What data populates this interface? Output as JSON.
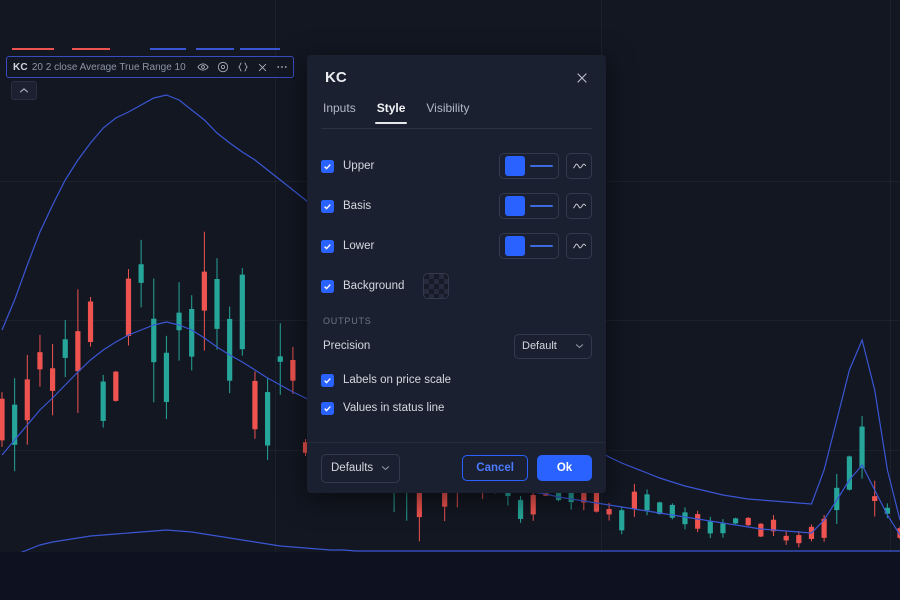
{
  "colors": {
    "accent": "#2962ff",
    "panel_bg": "#1b2030",
    "chart_bg": "#131722",
    "page_bg": "#0e1220",
    "band_line": "#3a56d4",
    "candle_up": "#26a69a",
    "candle_down": "#ef5350",
    "text_primary": "#d4d7de",
    "text_muted": "#6e7585"
  },
  "legend": {
    "name": "KC",
    "params": "20 2 close Average True Range 10",
    "icons": [
      "eye-icon",
      "settings-icon",
      "source-code-icon",
      "close-icon",
      "more-options-icon"
    ]
  },
  "chart": {
    "collapse_label": "⌃"
  },
  "modal": {
    "title": "KC",
    "close_label": "×",
    "tabs": [
      {
        "label": "Inputs",
        "active": false
      },
      {
        "label": "Style",
        "active": true
      },
      {
        "label": "Visibility",
        "active": false
      }
    ],
    "style_rows": [
      {
        "label": "Upper",
        "checked": true,
        "color": "#2962ff",
        "line_style": "wave-icon"
      },
      {
        "label": "Basis",
        "checked": true,
        "color": "#2962ff",
        "line_style": "wave-icon"
      },
      {
        "label": "Lower",
        "checked": true,
        "color": "#2962ff",
        "line_style": "wave-icon"
      }
    ],
    "background_row": {
      "label": "Background",
      "checked": true,
      "swatch": "transparent-checkered"
    },
    "outputs_section": {
      "header": "Outputs",
      "precision_label": "Precision",
      "precision_value": "Default",
      "checkboxes": [
        {
          "label": "Labels on price scale",
          "checked": true
        },
        {
          "label": "Values in status line",
          "checked": true
        }
      ]
    },
    "footer": {
      "defaults_label": "Defaults",
      "cancel_label": "Cancel",
      "ok_label": "Ok"
    }
  },
  "chart_data": {
    "type": "line",
    "title": "",
    "xlabel": "",
    "ylabel": "",
    "series": [
      {
        "name": "Upper",
        "values": [
          330,
          300,
          265,
          232,
          205,
          180,
          160,
          143,
          128,
          118,
          112,
          105,
          98,
          95,
          100,
          110,
          120,
          133,
          143,
          152,
          160,
          170,
          180,
          190,
          200,
          213,
          222,
          213,
          225,
          240,
          258,
          272,
          285,
          300,
          318,
          332,
          345,
          358,
          370,
          382,
          392,
          403,
          412,
          420,
          428,
          436,
          443,
          450,
          457,
          463,
          468,
          473,
          478,
          482,
          486,
          489,
          492,
          495,
          497,
          499,
          500,
          501,
          502,
          503,
          504,
          470,
          420,
          370,
          340,
          390,
          470,
          520
        ]
      },
      {
        "name": "Basis",
        "values": [
          455,
          440,
          425,
          410,
          398,
          385,
          372,
          360,
          350,
          342,
          335,
          330,
          325,
          322,
          325,
          330,
          338,
          347,
          355,
          362,
          370,
          378,
          385,
          392,
          398,
          405,
          410,
          415,
          420,
          427,
          434,
          440,
          447,
          453,
          459,
          464,
          469,
          474,
          478,
          482,
          486,
          489,
          492,
          494,
          497,
          499,
          501,
          503,
          505,
          507,
          509,
          511,
          513,
          515,
          517,
          519,
          521,
          523,
          525,
          527,
          529,
          530,
          531,
          532,
          533,
          520,
          500,
          480,
          465,
          490,
          515,
          535
        ]
      },
      {
        "name": "Lower",
        "values": [
          560,
          555,
          550,
          545,
          542,
          540,
          538,
          536,
          535,
          534,
          533,
          532,
          531,
          530,
          531,
          532,
          534,
          536,
          538,
          540,
          542,
          544,
          546,
          547,
          548,
          549,
          550,
          550,
          551,
          551,
          551,
          551,
          551,
          551,
          551,
          551,
          551,
          551,
          551,
          551,
          551,
          551,
          551,
          551,
          551,
          551,
          551,
          551,
          551,
          551,
          551,
          551,
          551,
          551,
          551,
          551,
          551,
          551,
          551,
          551,
          551,
          551,
          551,
          551,
          551,
          551,
          551,
          551,
          551,
          551,
          551,
          551
        ]
      }
    ],
    "legend_position": "top-left",
    "grid": true
  }
}
